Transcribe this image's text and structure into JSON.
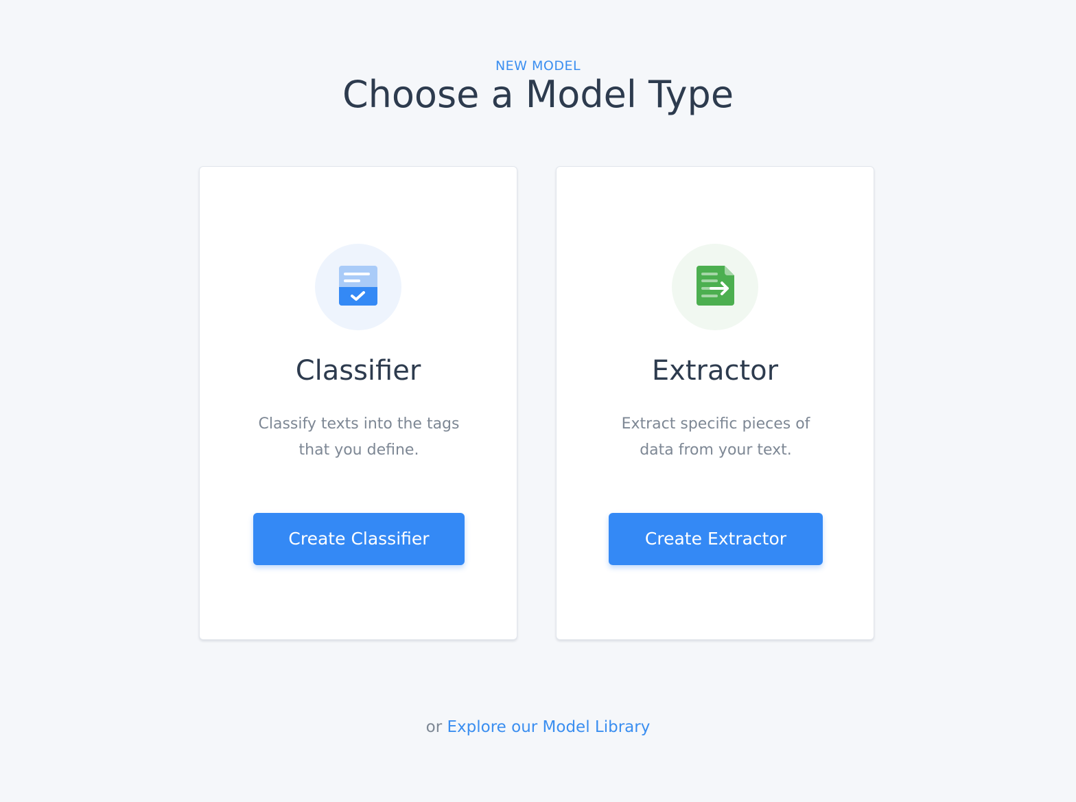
{
  "header": {
    "eyebrow": "NEW MODEL",
    "title": "Choose a Model Type"
  },
  "cards": [
    {
      "icon": "classifier-icon",
      "title": "Classifier",
      "description": "Classify texts into the tags that you define.",
      "button_label": "Create Classifier",
      "accent": "#3489f5"
    },
    {
      "icon": "extractor-icon",
      "title": "Extractor",
      "description": "Extract specific pieces of data from your text.",
      "button_label": "Create Extractor",
      "accent": "#4caf50"
    }
  ],
  "footer": {
    "prefix": "or",
    "link_label": "Explore our Model Library"
  },
  "colors": {
    "background": "#f5f7fa",
    "primary": "#3489f5",
    "title_text": "#2d3b4e",
    "muted_text": "#7d8794"
  }
}
